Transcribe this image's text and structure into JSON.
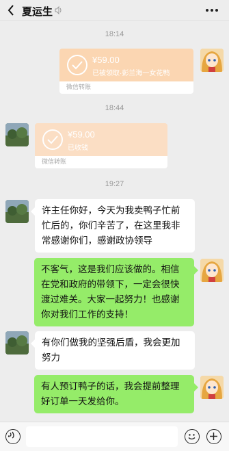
{
  "header": {
    "title": "夏运生"
  },
  "timestamps": [
    "18:14",
    "18:44",
    "19:27"
  ],
  "transfers": [
    {
      "amount": "¥59.00",
      "status": "已被领取·彭兰海一女花鸭",
      "footer": "微信转账"
    },
    {
      "amount": "¥59.00",
      "status": "已收钱",
      "footer": "微信转账"
    }
  ],
  "messages": [
    {
      "text": "许主任你好，今天为我卖鸭子忙前忙后的，你们辛苦了，在这里我非常感谢你们，感谢政协领导"
    },
    {
      "text": "不客气，这是我们应该做的。相信在党和政府的带领下，一定会很快渡过难关。大家一起努力！也感谢你对我们工作的支持！"
    },
    {
      "text": "有你们做我的坚强后盾，我会更加努力"
    },
    {
      "text": "有人预订鸭子的话，我会提前整理好订单一天发给你。"
    }
  ],
  "colors": {
    "green_bubble": "#95ec69",
    "transfer": "#fbd6b2",
    "background": "#ededed"
  }
}
